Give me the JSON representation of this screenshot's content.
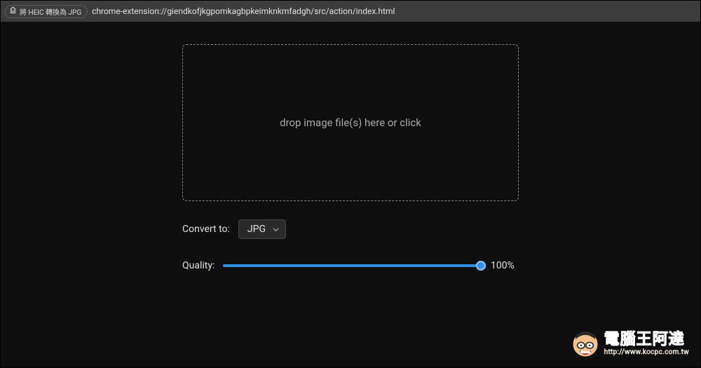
{
  "address_bar": {
    "badge_label": "將 HEIC 轉換為 JPG",
    "url": "chrome-extension://giendkofjkgpomkagbpkeimknkmfadgh/src/action/index.html"
  },
  "dropzone": {
    "prompt": "drop image file(s) here or click"
  },
  "controls": {
    "convert_label": "Convert to:",
    "format_selected": "JPG",
    "quality_label": "Quality:",
    "quality_value": "100%",
    "quality_percent": 100
  },
  "watermark": {
    "title": "電腦王阿達",
    "url": "http://www.kocpc.com.tw"
  }
}
